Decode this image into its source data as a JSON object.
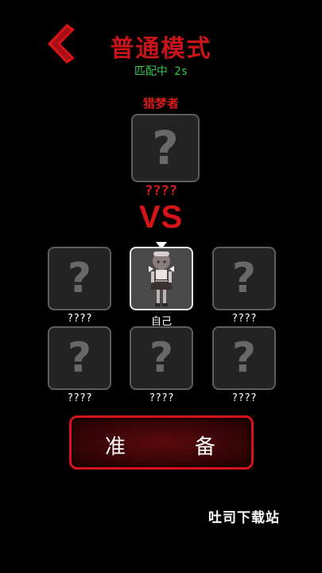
{
  "header": {
    "title": "普通模式",
    "status": "匹配中  2s"
  },
  "hunter": {
    "role_label": "猎梦者",
    "name": "????"
  },
  "versus_label": "VS",
  "players": [
    {
      "name": "????",
      "is_self": false
    },
    {
      "name": "自己",
      "is_self": true
    },
    {
      "name": "????",
      "is_self": false
    },
    {
      "name": "????",
      "is_self": false
    },
    {
      "name": "????",
      "is_self": false
    },
    {
      "name": "????",
      "is_self": false
    }
  ],
  "ready_button": {
    "char1": "准",
    "char2": "备"
  },
  "watermark": "吐司下载站",
  "colors": {
    "accent_red": "#d7141a",
    "status_green": "#35c64a",
    "slot_bg": "#232323",
    "slot_border": "#5d5d5d"
  },
  "icons": {
    "back": "chevron-left-icon",
    "unknown": "question-mark-icon",
    "self_marker": "triangle-down-icon"
  }
}
